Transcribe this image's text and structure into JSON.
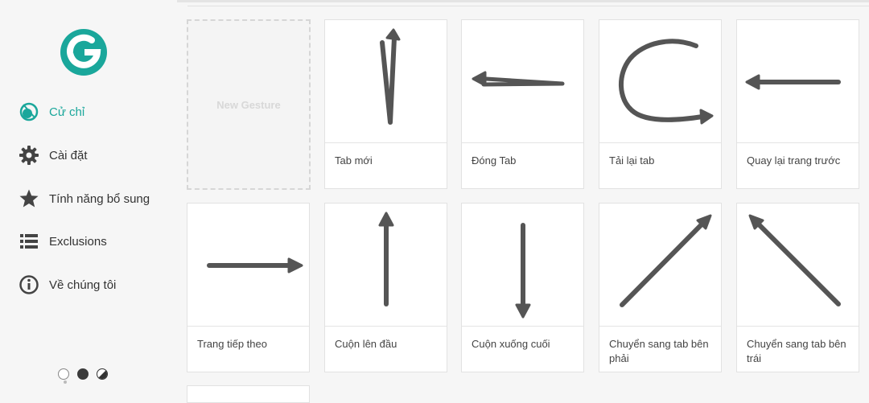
{
  "sidebar": {
    "logo_icon": "gesture-g-logo",
    "accent_color": "#1aa79b",
    "nav": [
      {
        "label": "Cử chỉ",
        "icon": "gesture-icon",
        "active": true
      },
      {
        "label": "Cài đặt",
        "icon": "gear-icon",
        "active": false
      },
      {
        "label": "Tính năng bổ sung",
        "icon": "star-icon",
        "active": false
      },
      {
        "label": "Exclusions",
        "icon": "list-icon",
        "active": false
      },
      {
        "label": "Về chúng tôi",
        "icon": "info-icon",
        "active": false
      }
    ],
    "themes": [
      "light",
      "dark",
      "high-contrast"
    ]
  },
  "new_gesture_label": "New Gesture",
  "gestures": [
    {
      "label": "Tab mới",
      "icon": "arrow-up-zigzag-icon"
    },
    {
      "label": "Đóng Tab",
      "icon": "arrow-left-double-icon"
    },
    {
      "label": "Tải lại tab",
      "icon": "arrow-curve-reload-icon"
    },
    {
      "label": "Quay lại trang trước",
      "icon": "arrow-left-icon"
    },
    {
      "label": "Trang tiếp theo",
      "icon": "arrow-right-icon"
    },
    {
      "label": "Cuộn lên đầu",
      "icon": "arrow-up-icon"
    },
    {
      "label": "Cuộn xuống cuối",
      "icon": "arrow-down-icon"
    },
    {
      "label": "Chuyển sang tab bên phải",
      "icon": "arrow-up-right-icon"
    },
    {
      "label": "Chuyển sang tab bên trái",
      "icon": "arrow-up-left-icon"
    }
  ]
}
